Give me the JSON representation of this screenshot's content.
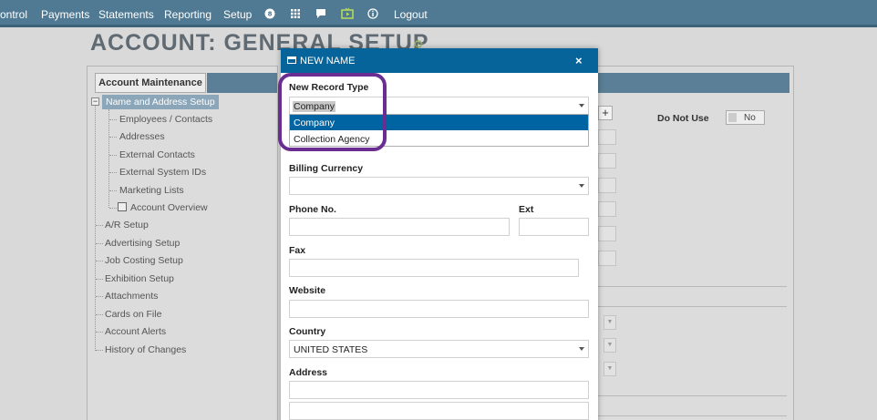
{
  "topnav": {
    "items": [
      "ontrol",
      "Payments",
      "Statements",
      "Reporting",
      "Setup"
    ],
    "logout": "Logout",
    "icons": [
      "badge-icon",
      "grid-icon",
      "chat-icon",
      "media-icon",
      "info-icon"
    ]
  },
  "page": {
    "title": "ACCOUNT: GENERAL SETUP"
  },
  "left_panel": {
    "tab_label": "Account Maintenance",
    "selected_item": "Name and Address Setup",
    "children": [
      "Employees / Contacts",
      "Addresses",
      "External Contacts",
      "External System IDs",
      "Marketing Lists",
      "Account Overview"
    ],
    "items": [
      "A/R Setup",
      "Advertising Setup",
      "Job Costing Setup",
      "Exhibition Setup",
      "Attachments",
      "Cards on File",
      "Account Alerts",
      "History of Changes"
    ]
  },
  "right_panel": {
    "plus_label": "+",
    "do_not_use_label": "Do Not Use",
    "do_not_use_value": "No"
  },
  "modal": {
    "title": "NEW NAME",
    "close": "×",
    "record_type": {
      "label": "New Record Type",
      "value": "Company",
      "options": [
        "Company",
        "Collection Agency"
      ]
    },
    "billing_currency": {
      "label": "Billing Currency",
      "value": ""
    },
    "phone": {
      "label": "Phone No.",
      "value": ""
    },
    "ext": {
      "label": "Ext",
      "value": ""
    },
    "fax": {
      "label": "Fax",
      "value": ""
    },
    "website": {
      "label": "Website",
      "value": ""
    },
    "country": {
      "label": "Country",
      "value": "UNITED STATES"
    },
    "address": {
      "label": "Address",
      "line1": "",
      "line2": ""
    }
  },
  "colors": {
    "nav": "#507a93",
    "modal_header": "#06649a",
    "dropdown_active": "#0064a3",
    "highlight_ring": "#6a2d91"
  }
}
